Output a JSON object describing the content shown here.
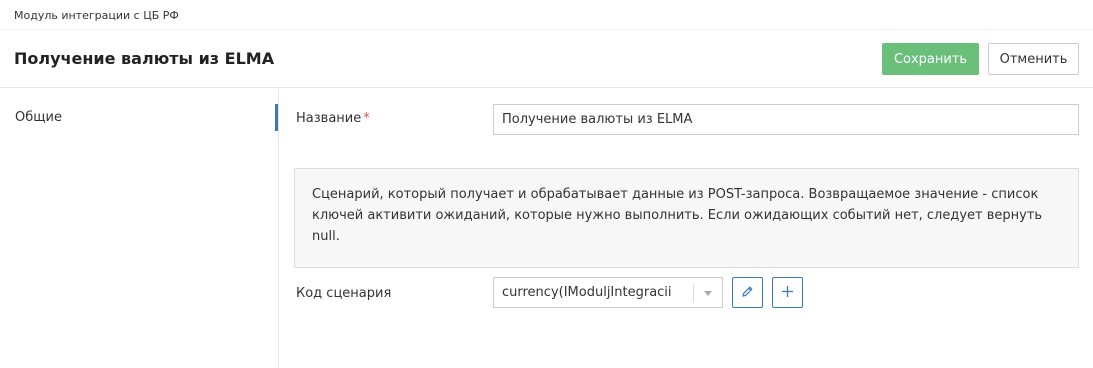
{
  "breadcrumb": "Модуль интеграции с ЦБ РФ",
  "header": {
    "title": "Получение валюты из ELMA",
    "save_label": "Сохранить",
    "cancel_label": "Отменить"
  },
  "sidebar": {
    "items": [
      {
        "label": "Общие",
        "active": true
      }
    ]
  },
  "form": {
    "name_label": "Название",
    "name_required_mark": "*",
    "name_value": "Получение валюты из ELMA",
    "info_text": "Сценарий, который получает и обрабатывает данные из POST-запроса. Возвращаемое значение - список ключей активити ожиданий, которые нужно выполнить. Если ожидающих событий нет, следует вернуть null.",
    "script_label": "Код сценария",
    "script_value": "currency(IModuljIntegracii"
  },
  "icons": {
    "select_arrow": "chevron-down-icon",
    "edit": "pencil-icon",
    "add": "plus-icon"
  },
  "colors": {
    "save_button": "#6abf7b",
    "accent": "#3c79b8",
    "required": "#d9534f"
  }
}
